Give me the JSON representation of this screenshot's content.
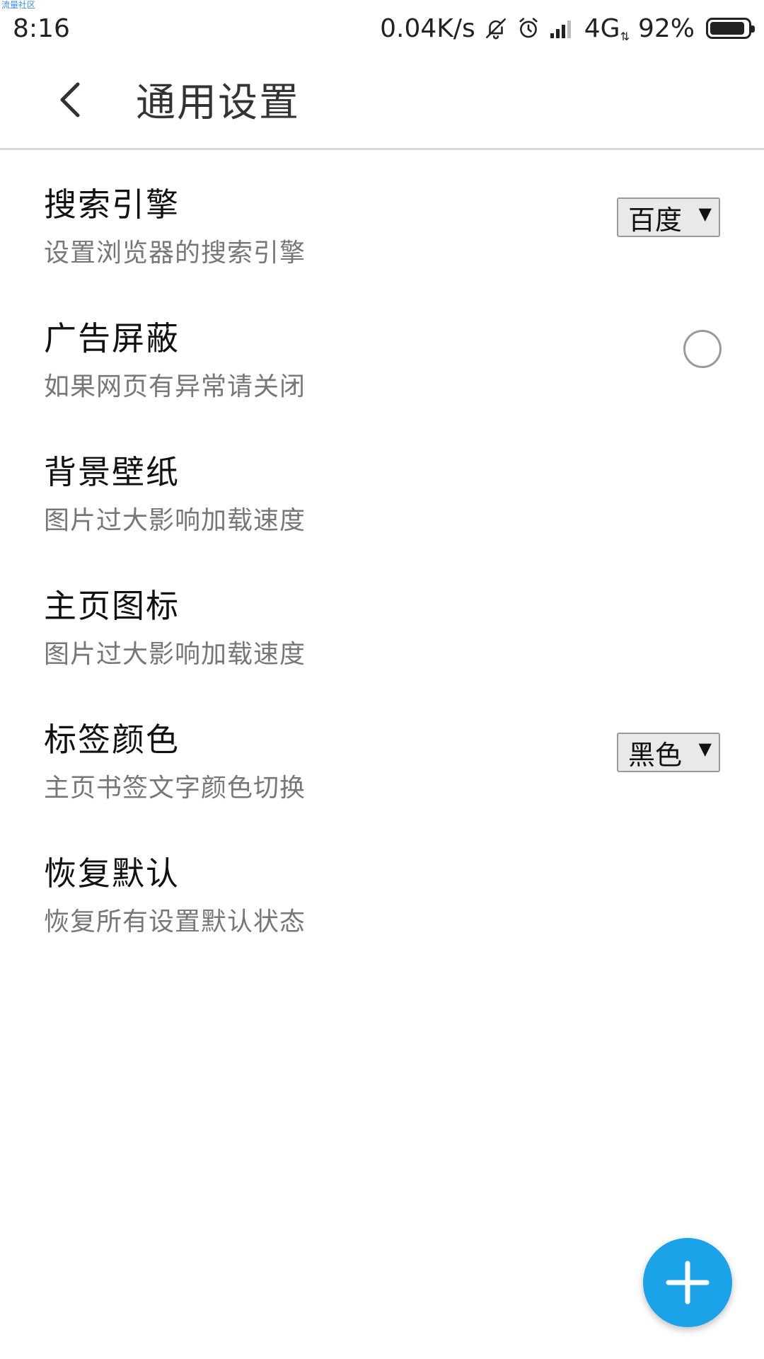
{
  "watermark": "流量社区",
  "status_bar": {
    "time": "8:16",
    "network_speed": "0.04K/s",
    "network_type": "4G",
    "battery_percent": "92%",
    "battery_level": 0.92,
    "icons": [
      "bell-off-icon",
      "alarm-icon",
      "signal-icon",
      "battery-icon"
    ]
  },
  "app_bar": {
    "title": "通用设置",
    "back_icon": "chevron-left-icon"
  },
  "settings": {
    "items": [
      {
        "title": "搜索引擎",
        "description": "设置浏览器的搜索引擎",
        "control": "dropdown",
        "value": "百度"
      },
      {
        "title": "广告屏蔽",
        "description": "如果网页有异常请关闭",
        "control": "radio",
        "checked": false
      },
      {
        "title": "背景壁纸",
        "description": "图片过大影响加载速度",
        "control": "none"
      },
      {
        "title": "主页图标",
        "description": "图片过大影响加载速度",
        "control": "none"
      },
      {
        "title": "标签颜色",
        "description": "主页书签文字颜色切换",
        "control": "dropdown",
        "value": "黑色"
      },
      {
        "title": "恢复默认",
        "description": "恢复所有设置默认状态",
        "control": "none"
      }
    ]
  },
  "fab": {
    "icon": "plus-icon",
    "color": "#1aa3e8"
  },
  "colors": {
    "accent": "#1aa3e8",
    "divider": "#d9d9d9",
    "secondary_text": "#777777"
  }
}
